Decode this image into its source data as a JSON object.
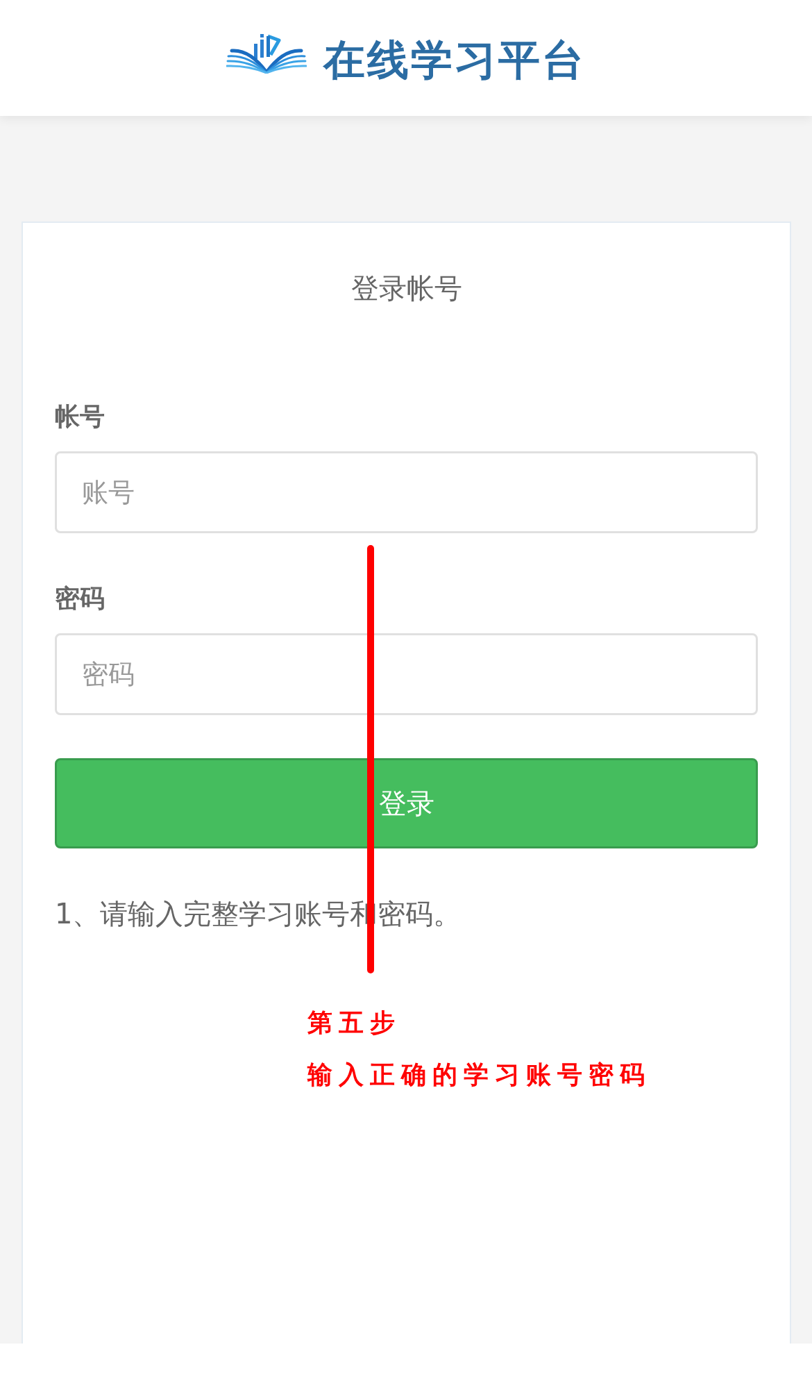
{
  "header": {
    "title": "在线学习平台"
  },
  "login_card": {
    "title": "登录帐号",
    "fields": [
      {
        "label": "帐号",
        "placeholder": "账号"
      },
      {
        "label": "密码",
        "placeholder": "密码"
      }
    ],
    "submit_button": "登录",
    "notes": [
      "1、请输入完整学习账号和密码。"
    ]
  },
  "annotation": {
    "step": "第五步",
    "instruction": "输入正确的学习账号密码"
  }
}
